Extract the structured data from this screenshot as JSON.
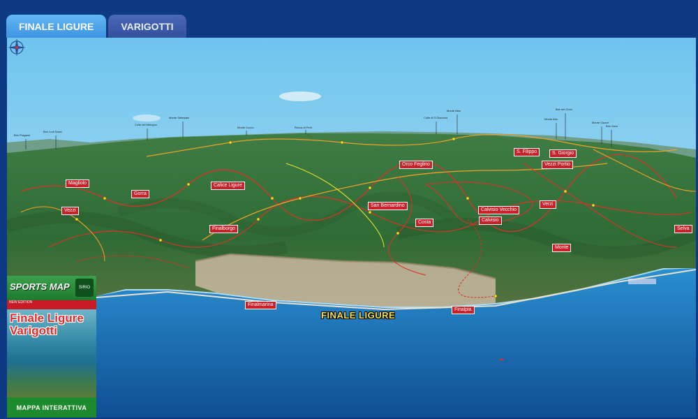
{
  "tabs": [
    {
      "label": "FINALE LIGURE",
      "active": true
    },
    {
      "label": "VARIGOTTI",
      "active": false
    }
  ],
  "map": {
    "main_town": "FINALE LIGURE",
    "town_labels": [
      {
        "id": "magliolo",
        "text": "Magliolo"
      },
      {
        "id": "gorra",
        "text": "Gorra"
      },
      {
        "id": "calice",
        "text": "Calice Ligure"
      },
      {
        "id": "vezzi",
        "text": "Vezzi"
      },
      {
        "id": "finalborgo",
        "text": "Finalborgo"
      },
      {
        "id": "orco",
        "text": "Orco Feglino"
      },
      {
        "id": "sanbernardino",
        "text": "San Bernardino"
      },
      {
        "id": "calvisio",
        "text": "Calvisio Vecchio"
      },
      {
        "id": "costa",
        "text": "Costa"
      },
      {
        "id": "calvisio2",
        "text": "Calvisio"
      },
      {
        "id": "verzi",
        "text": "Verzi"
      },
      {
        "id": "sfilippo",
        "text": "S. Filippo"
      },
      {
        "id": "sgiorgio",
        "text": "S. Giorgio"
      },
      {
        "id": "vezzi_portio",
        "text": "Vezzi Portio"
      },
      {
        "id": "selva",
        "text": "Selva"
      },
      {
        "id": "monte",
        "text": "Monte"
      },
      {
        "id": "finalmarina",
        "text": "Finalmarina"
      },
      {
        "id": "finalpia",
        "text": "Finalpia"
      }
    ],
    "peaks": [
      {
        "id": "p1",
        "text": "Bric Praganè"
      },
      {
        "id": "p2",
        "text": "Bric Ludi Sassi"
      },
      {
        "id": "p3",
        "text": "Colle del Melogno"
      },
      {
        "id": "p4",
        "text": "Monte Settepani"
      },
      {
        "id": "p5",
        "text": "Monte Cucco"
      },
      {
        "id": "p6",
        "text": "Rocca di Perti"
      },
      {
        "id": "p7",
        "text": "Colle di S.Giacomo"
      },
      {
        "id": "p8",
        "text": "Monte Mao"
      },
      {
        "id": "p9",
        "text": "Monte Alto"
      },
      {
        "id": "p10",
        "text": "Bric dei Crovi"
      },
      {
        "id": "p11",
        "text": "Monte Ciazze"
      },
      {
        "id": "p12",
        "text": "Bric Gora"
      }
    ]
  },
  "cover": {
    "brand": "SPORTS MAP",
    "logo": "SIRIO",
    "edition": "NEW EDITION",
    "title_line1": "Finale Ligure",
    "title_line2": "Varigotti",
    "footer": "MAPPA INTERATTIVA"
  },
  "colors": {
    "frame": "#0d3a82",
    "tab_active": "#4ba5ec",
    "tab_inactive": "#3d5dad",
    "sea": "#1d6fb8",
    "sky": "#8fd0f0",
    "trail_red": "#d9322a",
    "trail_orange": "#f0a028",
    "trail_yellow": "#e8e030",
    "label_red": "#c8212a"
  },
  "icons": [
    "compass-rose-icon"
  ]
}
